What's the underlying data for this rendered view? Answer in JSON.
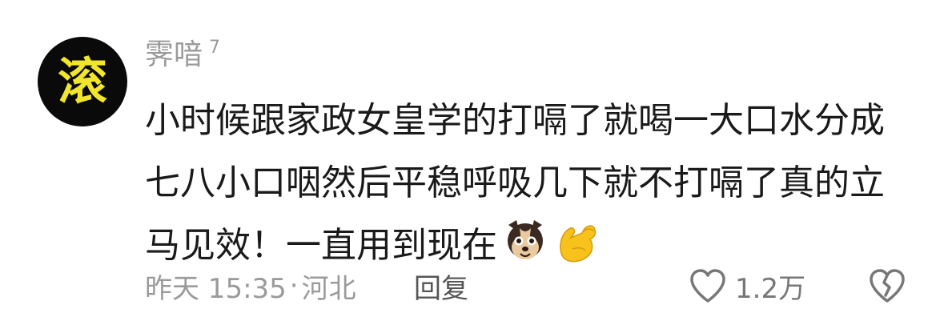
{
  "comment": {
    "avatar_char": "滚",
    "username": "霁喑",
    "user_badge": "7",
    "text": "小时候跟家政女皇学的打嗝了就喝一大口水分成七八小口咽然后平稳呼吸几下就不打嗝了真的立马见效！一直用到现在",
    "emojis": [
      "dog-face-emoji",
      "flexed-biceps-emoji"
    ],
    "time": "昨天 15:35",
    "separator": "·",
    "location": "河北",
    "reply_label": "回复",
    "like_count": "1.2万"
  },
  "colors": {
    "avatar_bg": "#0a0a0a",
    "avatar_char": "#f2e62c",
    "meta_text": "#9a9a9a",
    "body_text": "#1a1a1a"
  }
}
